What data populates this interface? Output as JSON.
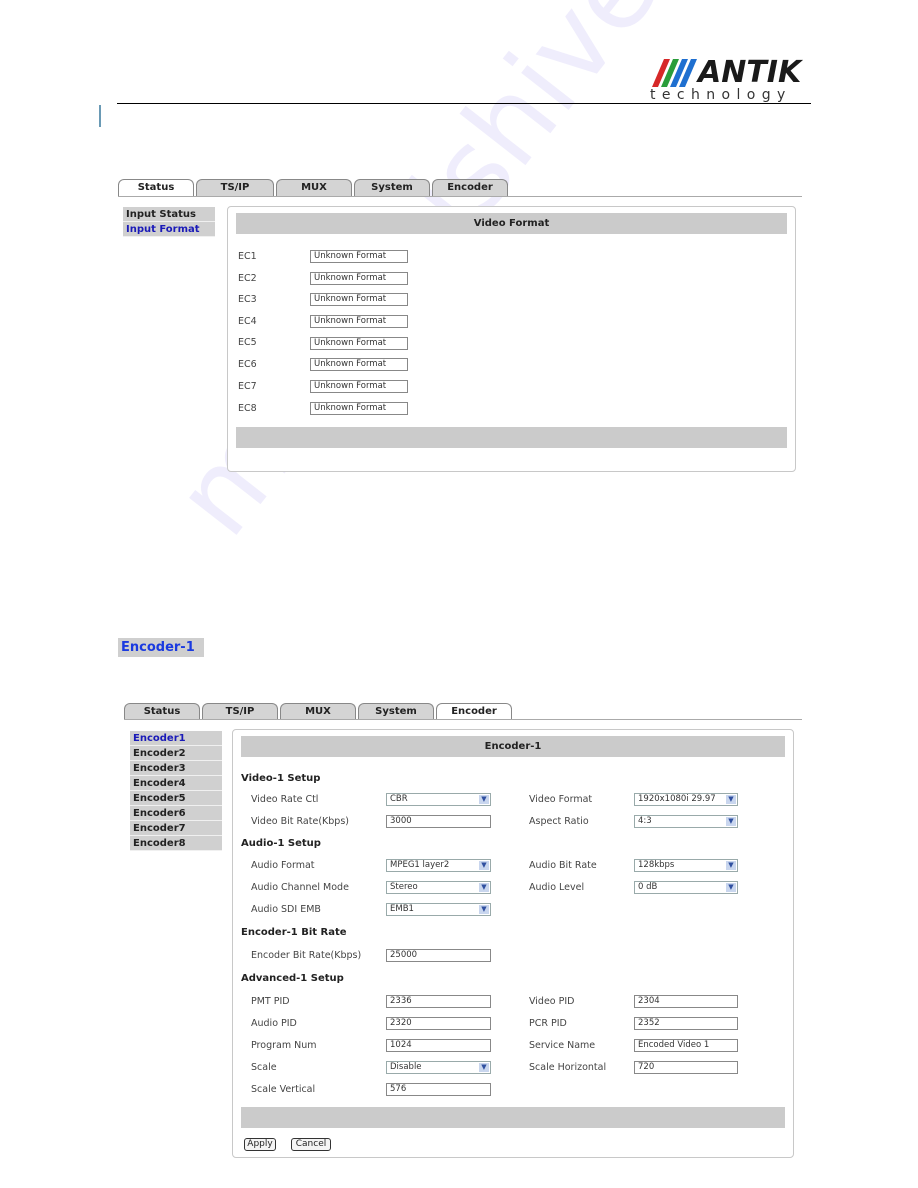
{
  "header": {
    "brand": "ANTIK",
    "brand_sub": "technology",
    "brand_colors": [
      "#d62828",
      "#2a9d3a",
      "#1e6fd0"
    ]
  },
  "screen1": {
    "tabs": [
      {
        "label": "Status",
        "active": true
      },
      {
        "label": "TS/IP",
        "active": false
      },
      {
        "label": "MUX",
        "active": false
      },
      {
        "label": "System",
        "active": false
      },
      {
        "label": "Encoder",
        "active": false
      }
    ],
    "subnav": [
      {
        "label": "Input Status",
        "active": false
      },
      {
        "label": "Input Format",
        "active": true
      }
    ],
    "panel_title": "Video Format",
    "rows": [
      {
        "label": "EC1",
        "value": "Unknown Format"
      },
      {
        "label": "EC2",
        "value": "Unknown Format"
      },
      {
        "label": "EC3",
        "value": "Unknown Format"
      },
      {
        "label": "EC4",
        "value": "Unknown Format"
      },
      {
        "label": "EC5",
        "value": "Unknown Format"
      },
      {
        "label": "EC6",
        "value": "Unknown Format"
      },
      {
        "label": "EC7",
        "value": "Unknown Format"
      },
      {
        "label": "EC8",
        "value": "Unknown Format"
      }
    ]
  },
  "section_caption": "Encoder-1",
  "screen2": {
    "tabs": [
      {
        "label": "Status",
        "active": false
      },
      {
        "label": "TS/IP",
        "active": false
      },
      {
        "label": "MUX",
        "active": false
      },
      {
        "label": "System",
        "active": false
      },
      {
        "label": "Encoder",
        "active": true
      }
    ],
    "subnav": [
      {
        "label": "Encoder1",
        "active": true
      },
      {
        "label": "Encoder2",
        "active": false
      },
      {
        "label": "Encoder3",
        "active": false
      },
      {
        "label": "Encoder4",
        "active": false
      },
      {
        "label": "Encoder5",
        "active": false
      },
      {
        "label": "Encoder6",
        "active": false
      },
      {
        "label": "Encoder7",
        "active": false
      },
      {
        "label": "Encoder8",
        "active": false
      }
    ],
    "panel_title": "Encoder-1",
    "sections": {
      "video": "Video-1 Setup",
      "audio": "Audio-1 Setup",
      "bitrate": "Encoder-1 Bit Rate",
      "advanced": "Advanced-1 Setup"
    },
    "fields": {
      "video_rate_ctl": {
        "label": "Video Rate Ctl",
        "value": "CBR"
      },
      "video_bit_rate": {
        "label": "Video Bit Rate(Kbps)",
        "value": "3000"
      },
      "video_format": {
        "label": "Video Format",
        "value": "1920x1080i 29.97"
      },
      "aspect_ratio": {
        "label": "Aspect Ratio",
        "value": "4:3"
      },
      "audio_format": {
        "label": "Audio Format",
        "value": "MPEG1 layer2"
      },
      "audio_channel_mode": {
        "label": "Audio Channel Mode",
        "value": "Stereo"
      },
      "audio_sdi_emb": {
        "label": "Audio SDI EMB",
        "value": "EMB1"
      },
      "audio_bit_rate": {
        "label": "Audio Bit Rate",
        "value": "128kbps"
      },
      "audio_level": {
        "label": "Audio Level",
        "value": "0 dB"
      },
      "encoder_bit_rate": {
        "label": "Encoder Bit Rate(Kbps)",
        "value": "25000"
      },
      "pmt_pid": {
        "label": "PMT PID",
        "value": "2336"
      },
      "audio_pid": {
        "label": "Audio PID",
        "value": "2320"
      },
      "program_num": {
        "label": "Program Num",
        "value": "1024"
      },
      "scale": {
        "label": "Scale",
        "value": "Disable"
      },
      "scale_vertical": {
        "label": "Scale Vertical",
        "value": "576"
      },
      "video_pid": {
        "label": "Video PID",
        "value": "2304"
      },
      "pcr_pid": {
        "label": "PCR PID",
        "value": "2352"
      },
      "service_name": {
        "label": "Service Name",
        "value": "Encoded Video 1"
      },
      "scale_horizontal": {
        "label": "Scale Horizontal",
        "value": "720"
      }
    },
    "buttons": {
      "apply": "Apply",
      "cancel": "Cancel"
    }
  },
  "watermark": "manualshive.com"
}
